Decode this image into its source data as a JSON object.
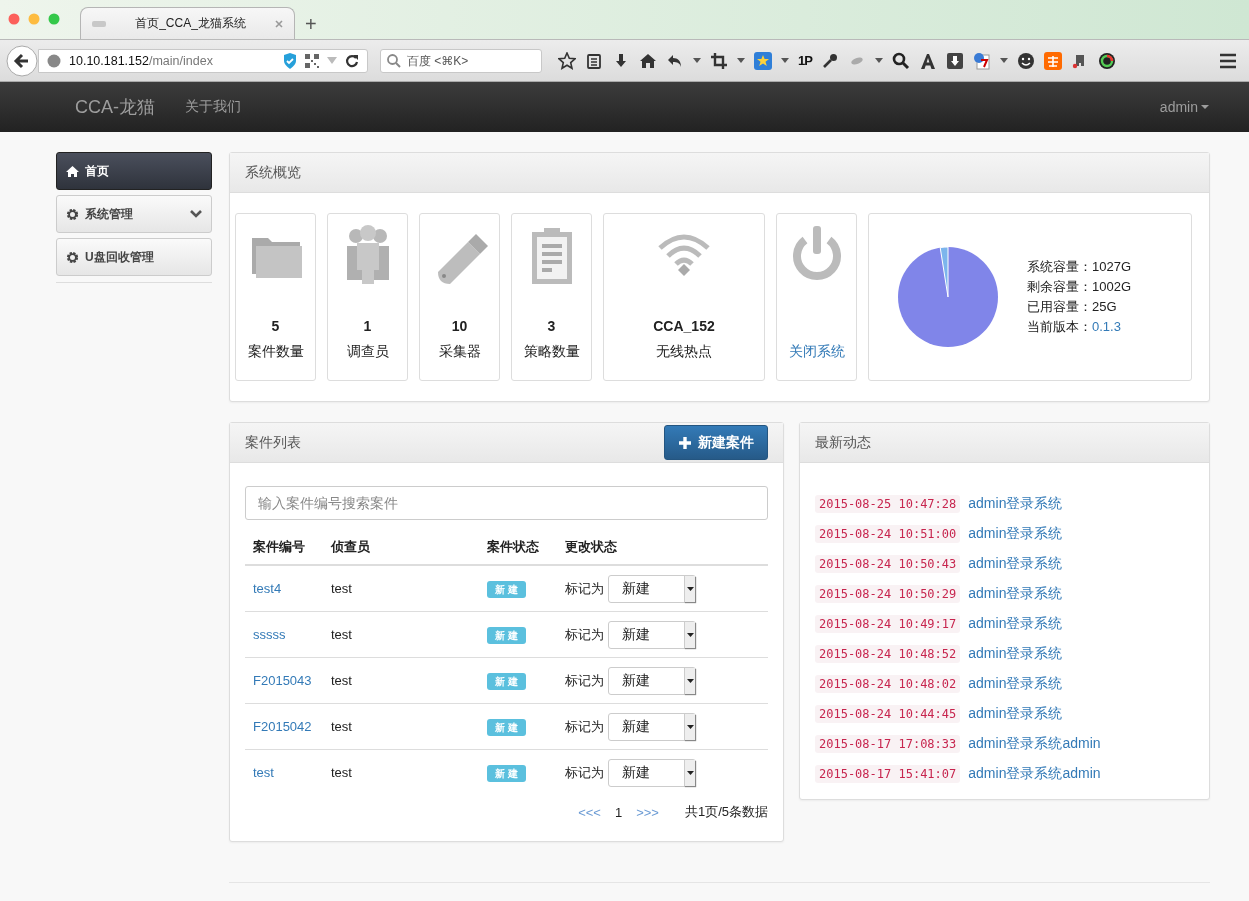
{
  "browser": {
    "tab_title": "首页_CCA_龙猫系统",
    "new_tab": "+",
    "url_host": "10.10.181.152",
    "url_path": "/main/index",
    "search_placeholder": "百度 <⌘K>",
    "toolbar_text": "1P"
  },
  "navbar": {
    "brand": "CCA-龙猫",
    "links": [
      "关于我们"
    ],
    "user": "admin"
  },
  "sidebar": {
    "items": [
      {
        "label": "首页",
        "selected": true,
        "has_submenu": false
      },
      {
        "label": "系统管理",
        "selected": false,
        "has_submenu": true
      },
      {
        "label": "U盘回收管理",
        "selected": false,
        "has_submenu": false
      }
    ]
  },
  "overview": {
    "title": "系统概览",
    "stats": [
      {
        "kind": "cases",
        "value": "5",
        "label": "案件数量"
      },
      {
        "kind": "investigators",
        "value": "1",
        "label": "调查员"
      },
      {
        "kind": "collectors",
        "value": "10",
        "label": "采集器"
      },
      {
        "kind": "policies",
        "value": "3",
        "label": "策略数量"
      },
      {
        "kind": "hotspot",
        "value": "CCA_152",
        "label": "无线热点"
      },
      {
        "kind": "shutdown",
        "label": "关闭系统"
      }
    ],
    "storage": [
      {
        "label": "系统容量：",
        "value": "1027G",
        "link": false
      },
      {
        "label": "剩余容量：",
        "value": "1002G",
        "link": false
      },
      {
        "label": "已用容量：",
        "value": "25G",
        "link": false
      },
      {
        "label": "当前版本：",
        "value": "0.1.3",
        "link": true
      }
    ]
  },
  "cases": {
    "title": "案件列表",
    "new_button": "新建案件",
    "search_placeholder": "输入案件编号搜索案件",
    "columns": [
      "案件编号",
      "侦查员",
      "案件状态",
      "更改状态"
    ],
    "rows": [
      {
        "id": "test4",
        "investigator": "test",
        "status": "新 建",
        "mark_label": "标记为",
        "mark_value": "新建"
      },
      {
        "id": "sssss",
        "investigator": "test",
        "status": "新 建",
        "mark_label": "标记为",
        "mark_value": "新建"
      },
      {
        "id": "F2015043",
        "investigator": "test",
        "status": "新 建",
        "mark_label": "标记为",
        "mark_value": "新建"
      },
      {
        "id": "F2015042",
        "investigator": "test",
        "status": "新 建",
        "mark_label": "标记为",
        "mark_value": "新建"
      },
      {
        "id": "test",
        "investigator": "test",
        "status": "新 建",
        "mark_label": "标记为",
        "mark_value": "新建"
      }
    ],
    "pagination": {
      "prev": "<<<",
      "page": "1",
      "next": ">>>",
      "summary": "共1页/5条数据"
    }
  },
  "activity": {
    "title": "最新动态",
    "items": [
      {
        "time": "2015-08-25 10:47:28",
        "text": "admin登录系统"
      },
      {
        "time": "2015-08-24 10:51:00",
        "text": "admin登录系统"
      },
      {
        "time": "2015-08-24 10:50:43",
        "text": "admin登录系统"
      },
      {
        "time": "2015-08-24 10:50:29",
        "text": "admin登录系统"
      },
      {
        "time": "2015-08-24 10:49:17",
        "text": "admin登录系统"
      },
      {
        "time": "2015-08-24 10:48:52",
        "text": "admin登录系统"
      },
      {
        "time": "2015-08-24 10:48:02",
        "text": "admin登录系统"
      },
      {
        "time": "2015-08-24 10:44:45",
        "text": "admin登录系统"
      },
      {
        "time": "2015-08-17 17:08:33",
        "text": "admin登录系统admin"
      },
      {
        "time": "2015-08-17 15:41:07",
        "text": "admin登录系统admin"
      }
    ]
  }
}
